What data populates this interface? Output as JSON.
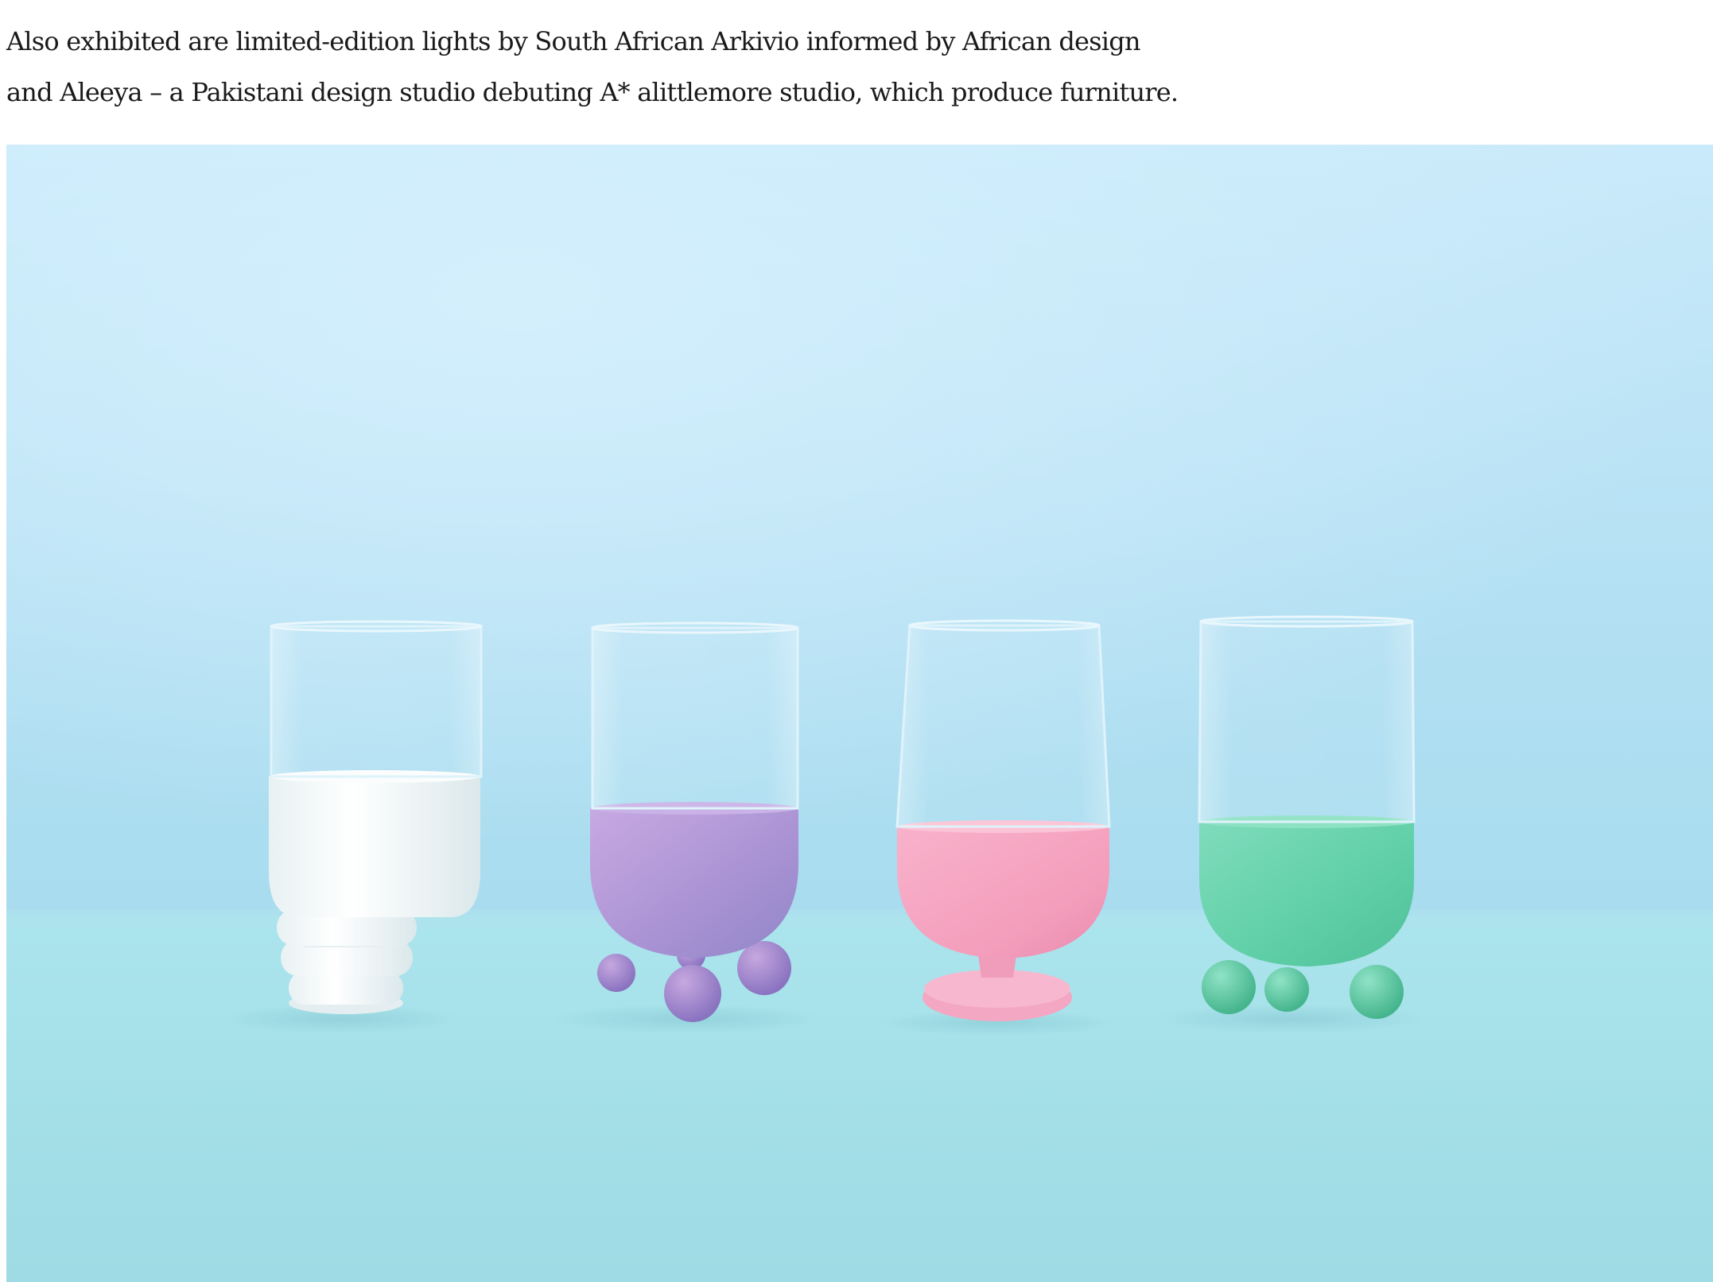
{
  "article": {
    "paragraph_lines": [
      "Also exhibited are limited-edition lights by South African Arkivio informed by African design",
      "and Aleeya – a Pakistani design studio debuting A* alittlemore studio, which produce furniture."
    ]
  },
  "photo": {
    "subject": "four glass tumblers with coloured bases on a pale blue backdrop",
    "items": [
      {
        "name": "white-ringed-glass",
        "color": "#f4f8f9"
      },
      {
        "name": "lilac-ball-feet-glass",
        "color": "#b39ad6"
      },
      {
        "name": "pink-pedestal-glass",
        "color": "#f4a8c3"
      },
      {
        "name": "mint-ball-feet-glass",
        "color": "#6fd4b0"
      }
    ],
    "colors": {
      "backdrop_top": "#c8e9fa",
      "backdrop_bottom": "#a6dff0",
      "surface": "#a3e1e8"
    }
  }
}
